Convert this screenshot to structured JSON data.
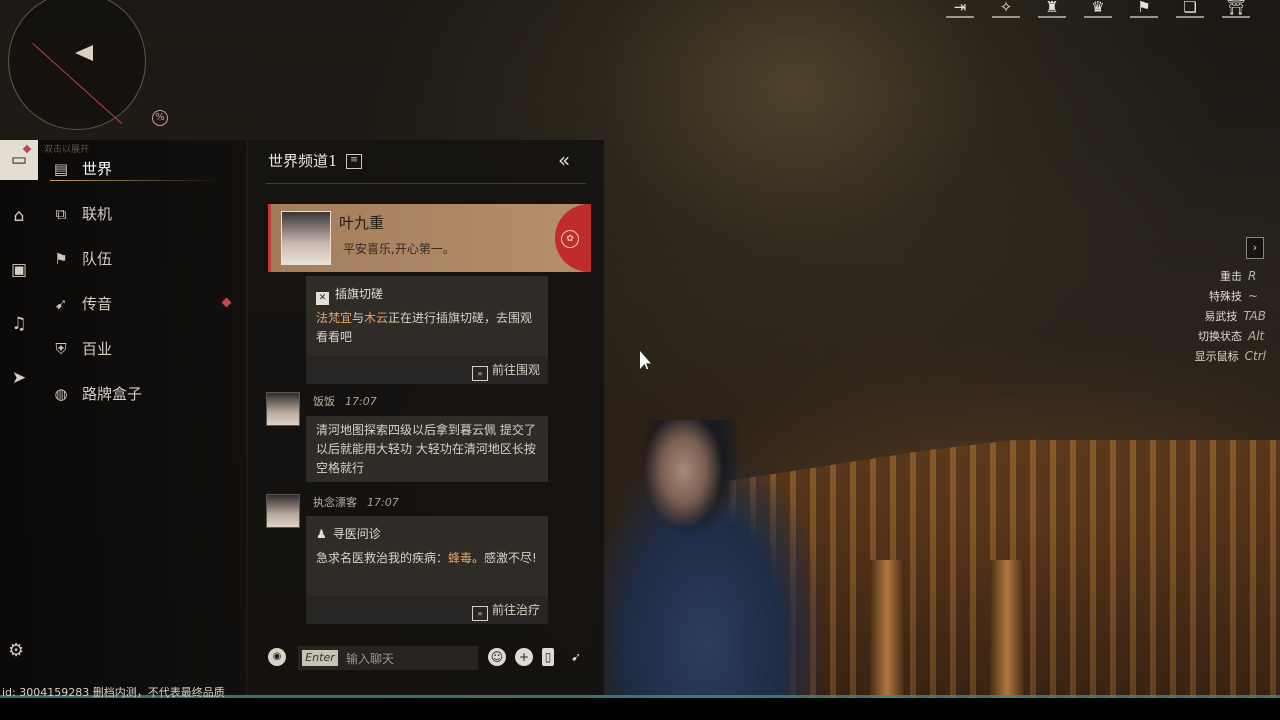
{
  "top_icons": [
    "exit-icon",
    "compass-icon",
    "lamp-icon",
    "armor-icon",
    "map-flag-icon",
    "book-icon",
    "gate-icon"
  ],
  "minimap": {
    "badge": "%"
  },
  "sidebar": {
    "faint_text": "双击以展开",
    "categories": [
      {
        "label": "世界",
        "icon": "world-icon"
      },
      {
        "label": "联机",
        "icon": "connect-icon"
      },
      {
        "label": "队伍",
        "icon": "flag-icon"
      },
      {
        "label": "传音",
        "icon": "bird-icon"
      },
      {
        "label": "百业",
        "icon": "guild-icon"
      },
      {
        "label": "路牌盒子",
        "icon": "signpost-icon"
      }
    ]
  },
  "chat": {
    "channel_title": "世界频道1",
    "profile": {
      "name": "叶九重",
      "motto": "平安喜乐,开心第一。"
    },
    "messages": [
      {
        "type": "event",
        "title": "插旗切磋",
        "name1": "法梵宜",
        "mid1": "与",
        "name2": "木云",
        "rest": "正在进行插旗切磋，去围观看看吧",
        "action": "前往围观"
      },
      {
        "type": "text",
        "sender": "饭饭",
        "time": "17:07",
        "text": "清河地图探索四级以后拿到暮云佩 提交了以后就能用大轻功 大轻功在清河地区长按空格就行"
      },
      {
        "type": "event",
        "sender": "执念漂客",
        "time": "17:07",
        "title": "寻医问诊",
        "pre": "急求名医救治我的疾病：",
        "disease": "蜂毒",
        "post": "。感激不尽!",
        "action": "前往治疗"
      }
    ],
    "input": {
      "enter_key": "Enter",
      "placeholder": "输入聊天"
    }
  },
  "keybinds": [
    {
      "label": "重击",
      "key": "R"
    },
    {
      "label": "特殊技",
      "key": "~"
    },
    {
      "label": "易武技",
      "key": "TAB"
    },
    {
      "label": "切换状态",
      "key": "Alt"
    },
    {
      "label": "显示鼠标",
      "key": "Ctrl"
    }
  ],
  "footer": {
    "id_text": "id: 3004159283  删档内测，不代表最终品质"
  }
}
